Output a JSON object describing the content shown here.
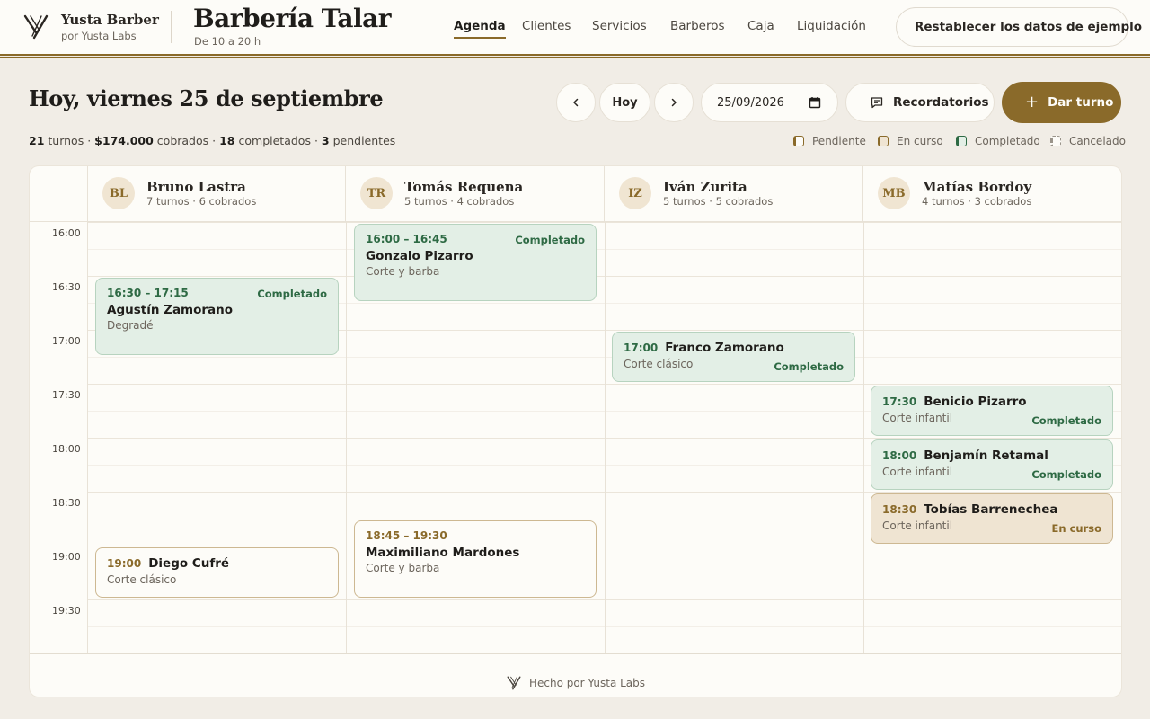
{
  "brand": {
    "name": "Yusta Barber",
    "sub": "por Yusta Labs"
  },
  "shop": {
    "name": "Barbería Talar",
    "hours": "De 10 a 20 h"
  },
  "nav": [
    "Agenda",
    "Clientes",
    "Servicios",
    "Barberos",
    "Caja",
    "Liquidación"
  ],
  "nav_active": "Agenda",
  "reset_label": "Restablecer los datos de ejemplo",
  "toolbar": {
    "title": "Hoy, viernes 25 de septiembre",
    "today_label": "Hoy",
    "date_value": "25/09/2026",
    "reminders_label": "Recordatorios",
    "new_label": "Dar turno"
  },
  "summary": {
    "turnos": "21",
    "turnos_label": "turnos",
    "cobrados": "$174.000",
    "cobrados_label": "cobrados",
    "completados": "18",
    "completados_label": "completados",
    "pendientes": "3",
    "pendientes_label": "pendientes",
    "sep": "·"
  },
  "legend": [
    "Pendiente",
    "En curso",
    "Completado",
    "Cancelado"
  ],
  "colors": {
    "accent": "#8a6a2a",
    "completed_bg": "#e3efe6",
    "completed_text": "#2e6a44",
    "in_progress_bg": "#efe4d2",
    "background": "#f1ede6"
  },
  "times": [
    "16:00",
    "16:30",
    "17:00",
    "17:30",
    "18:00",
    "18:30",
    "19:00",
    "19:30"
  ],
  "barbers": [
    {
      "initials": "BL",
      "name": "Bruno Lastra",
      "stats": "7 turnos · 6 cobrados"
    },
    {
      "initials": "TR",
      "name": "Tomás Requena",
      "stats": "5 turnos · 4 cobrados"
    },
    {
      "initials": "IZ",
      "name": "Iván Zurita",
      "stats": "5 turnos · 5 cobrados"
    },
    {
      "initials": "MB",
      "name": "Matías Bordoy",
      "stats": "4 turnos · 3 cobrados"
    }
  ],
  "appointments": [
    {
      "time": "16:30 – 17:15",
      "client": "Agustín Zamorano",
      "service": "Degradé",
      "status": "Completado"
    },
    {
      "time": "19:00",
      "client": "Diego Cufré",
      "service": "Corte clásico",
      "status": ""
    },
    {
      "time": "16:00 – 16:45",
      "client": "Gonzalo Pizarro",
      "service": "Corte y barba",
      "status": "Completado"
    },
    {
      "time": "18:45 – 19:30",
      "client": "Maximiliano Mardones",
      "service": "Corte y barba",
      "status": ""
    },
    {
      "time": "17:00",
      "client": "Franco Zamorano",
      "service": "Corte clásico",
      "status": "Completado"
    },
    {
      "time": "17:30",
      "client": "Benicio Pizarro",
      "service": "Corte infantil",
      "status": "Completado"
    },
    {
      "time": "18:00",
      "client": "Benjamín Retamal",
      "service": "Corte infantil",
      "status": "Completado"
    },
    {
      "time": "18:30",
      "client": "Tobías Barrenechea",
      "service": "Corte infantil",
      "status": "En curso"
    }
  ],
  "footer": "Hecho por Yusta Labs"
}
